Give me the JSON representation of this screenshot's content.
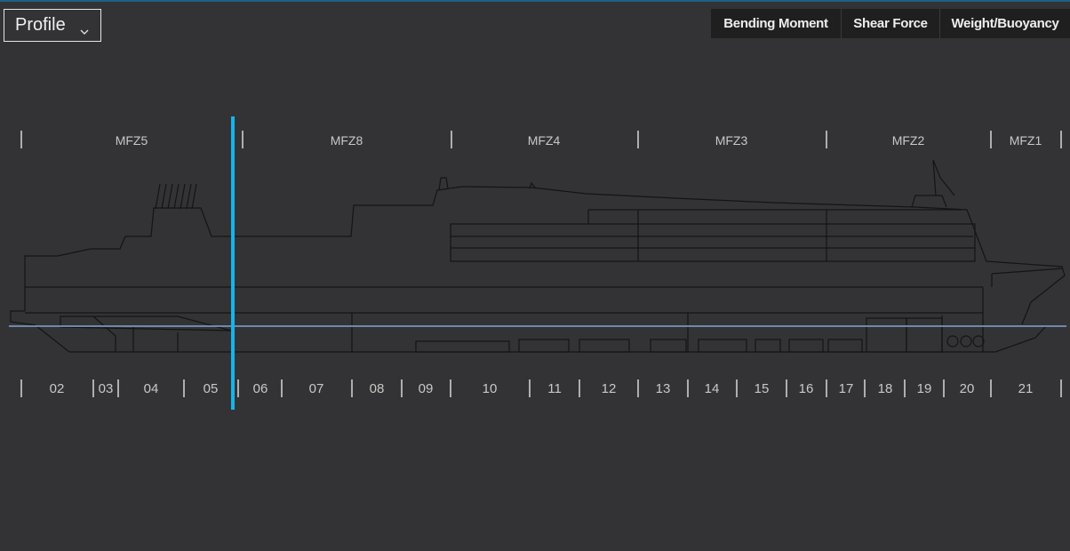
{
  "view_selector": {
    "label": "Profile",
    "icon": "chevron-down-icon"
  },
  "toolbar": {
    "buttons": [
      {
        "label": "Bending Moment"
      },
      {
        "label": "Shear Force"
      },
      {
        "label": "Weight/Buoyancy"
      }
    ]
  },
  "zones": [
    {
      "label": "MFZ5"
    },
    {
      "label": "MFZ8"
    },
    {
      "label": "MFZ4"
    },
    {
      "label": "MFZ3"
    },
    {
      "label": "MFZ2"
    },
    {
      "label": "MFZ1"
    }
  ],
  "frames": [
    {
      "label": "02"
    },
    {
      "label": "03"
    },
    {
      "label": "04"
    },
    {
      "label": "05"
    },
    {
      "label": "06"
    },
    {
      "label": "07"
    },
    {
      "label": "08"
    },
    {
      "label": "09"
    },
    {
      "label": "10"
    },
    {
      "label": "11"
    },
    {
      "label": "12"
    },
    {
      "label": "13"
    },
    {
      "label": "14"
    },
    {
      "label": "15"
    },
    {
      "label": "16"
    },
    {
      "label": "17"
    },
    {
      "label": "18"
    },
    {
      "label": "19"
    },
    {
      "label": "20"
    },
    {
      "label": "21"
    }
  ],
  "colors": {
    "background": "#333335",
    "selection_line": "#17b3ec",
    "waterline": "#6f87ad",
    "ship_outline": "#141414"
  }
}
